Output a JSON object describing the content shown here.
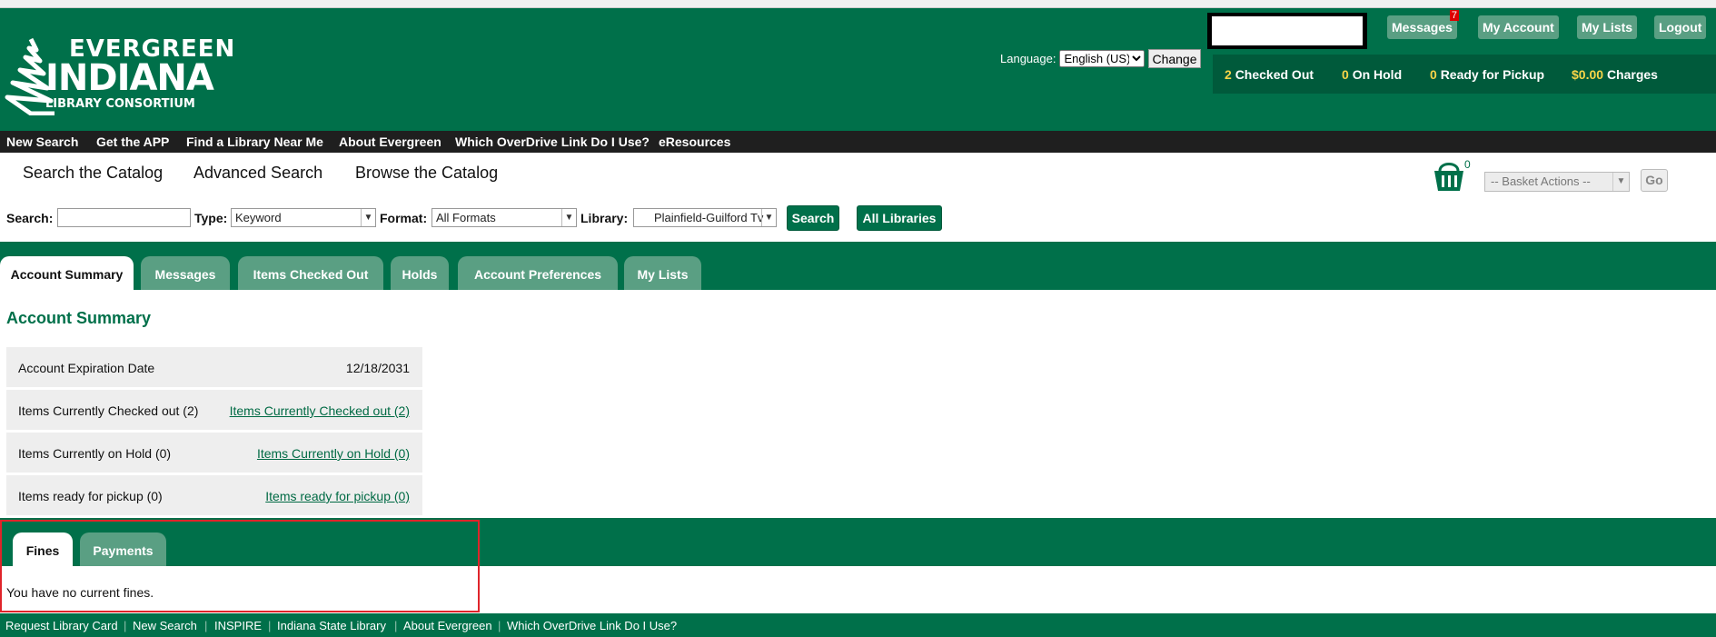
{
  "header": {
    "logo": {
      "line1": "EVERGREEN",
      "line2": "INDIANA",
      "line3": "LIBRARY CONSORTIUM"
    },
    "language_label": "Language:",
    "language_value": "English (US)",
    "change_label": "Change",
    "buttons": {
      "messages": "Messages",
      "messages_badge": "7",
      "my_account": "My Account",
      "my_lists": "My Lists",
      "logout": "Logout"
    },
    "status": {
      "checked_out_count": "2",
      "checked_out_label": "Checked Out",
      "on_hold_count": "0",
      "on_hold_label": "On Hold",
      "ready_count": "0",
      "ready_label": "Ready for Pickup",
      "charges_amount": "$0.00",
      "charges_label": "Charges"
    }
  },
  "nav": [
    "New Search",
    "Get the APP",
    "Find a Library Near Me",
    "About Evergreen",
    "Which OverDrive Link Do I Use?",
    "eResources"
  ],
  "search_tabs": {
    "search": "Search the Catalog",
    "advanced": "Advanced Search",
    "browse": "Browse the Catalog"
  },
  "basket": {
    "count": "0",
    "actions": "-- Basket Actions --",
    "go": "Go"
  },
  "search": {
    "search_label": "Search:",
    "search_value": "",
    "type_label": "Type:",
    "type_value": "Keyword",
    "format_label": "Format:",
    "format_value": "All Formats",
    "library_label": "Library:",
    "library_value": "Plainfield-Guilford Tv",
    "search_button": "Search",
    "all_libraries_button": "All Libraries"
  },
  "account_tabs": [
    "Account Summary",
    "Messages",
    "Items Checked Out",
    "Holds",
    "Account Preferences",
    "My Lists"
  ],
  "summary": {
    "title": "Account Summary",
    "rows": [
      {
        "label": "Account Expiration Date",
        "value": "12/18/2031"
      },
      {
        "label": "Items Currently Checked out (2)",
        "value": "Items Currently Checked out (2)"
      },
      {
        "label": "Items Currently on Hold (0)",
        "value": "Items Currently on Hold (0)"
      },
      {
        "label": "Items ready for pickup (0)",
        "value": "Items ready for pickup (0)"
      }
    ]
  },
  "fines": {
    "tabs": [
      "Fines",
      "Payments"
    ],
    "message": "You have no current fines."
  },
  "footer": [
    "Request Library Card",
    "New Search",
    "INSPIRE",
    "Indiana State Library",
    "About Evergreen",
    "Which OverDrive Link Do I Use?"
  ],
  "colors": {
    "brand_green": "#00704a",
    "tab_green": "#5a9f83",
    "highlight_red": "#e0242a",
    "count_yellow": "#f7d548"
  },
  "icons": {
    "basket": "basket-icon",
    "logo": "evergreen-tree-logo"
  }
}
